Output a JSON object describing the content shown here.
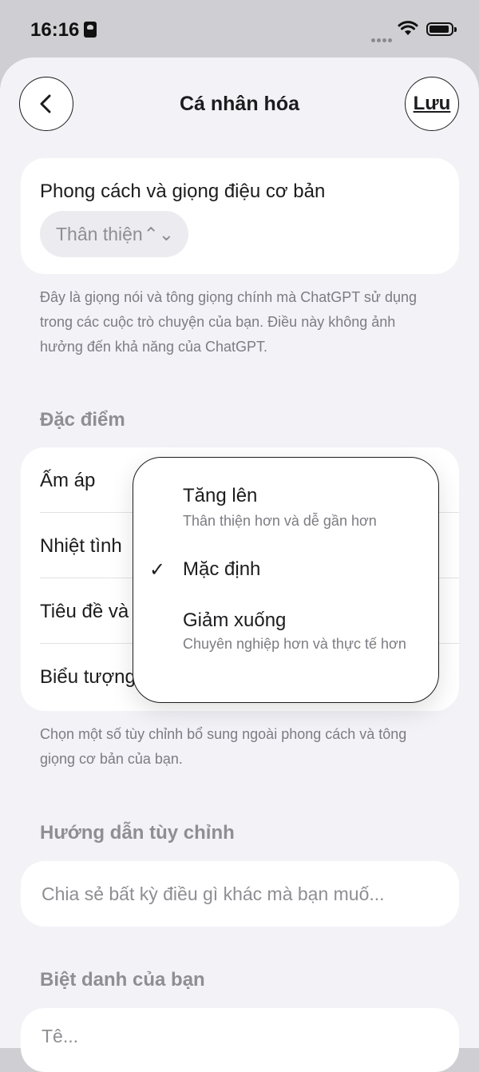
{
  "status_bar": {
    "time": "16:16"
  },
  "header": {
    "title": "Cá nhân hóa",
    "save_label": "Lưu"
  },
  "style_card": {
    "label": "Phong cách và giọng điệu cơ bản",
    "selected": "Thân thiện",
    "note": "Đây là giọng nói và tông giọng chính mà ChatGPT sử dụng trong các cuộc trò chuyện của bạn. Điều này không ảnh hưởng đến khả năng của ChatGPT."
  },
  "traits": {
    "header": "Đặc điểm",
    "rows": [
      {
        "label": "Ấm áp"
      },
      {
        "label": "Nhiệt tình"
      },
      {
        "label": "Tiêu đề và"
      },
      {
        "label": "Biểu tượng"
      }
    ],
    "note": "Chọn một số tùy chỉnh bổ sung ngoài phong cách và tông giọng cơ bản của bạn."
  },
  "dropdown": {
    "options": [
      {
        "title": "Tăng lên",
        "subtitle": "Thân thiện hơn và dễ gần hơn"
      },
      {
        "title": "Mặc định",
        "subtitle": "",
        "selected": true
      },
      {
        "title": "Giảm xuống",
        "subtitle": "Chuyên nghiệp hơn và thực tế hơn"
      }
    ]
  },
  "custom_instructions": {
    "header": "Hướng dẫn tùy chỉnh",
    "placeholder": "Chia sẻ bất kỳ điều gì khác mà bạn muố..."
  },
  "nickname": {
    "header": "Biệt danh của bạn",
    "placeholder": "Tê..."
  }
}
